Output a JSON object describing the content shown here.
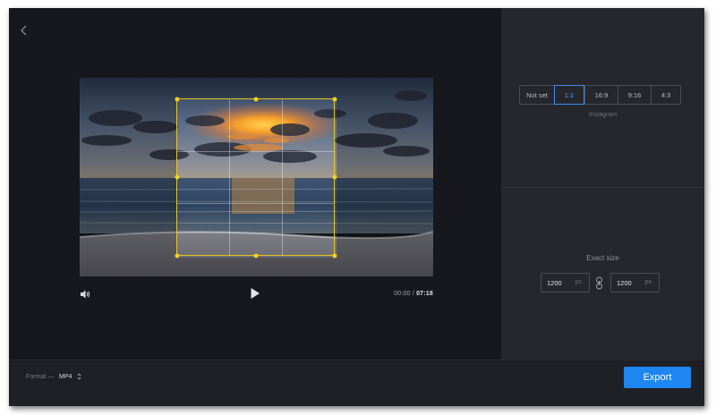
{
  "window": {
    "back_icon": "chevron-left-icon"
  },
  "player": {
    "current_time": "00:00",
    "separator": "/",
    "total_time": "07:18",
    "volume_icon": "speaker-icon",
    "play_icon": "play-icon"
  },
  "crop": {
    "border_color": "#e7c51d"
  },
  "aspect_ratio": {
    "options": [
      "Not set",
      "1:1",
      "16:9",
      "9:16",
      "4:3"
    ],
    "selected": "1:1",
    "caption": "Instagram"
  },
  "exact_size": {
    "label": "Exact size",
    "width": "1200",
    "height": "1200",
    "unit": "px",
    "link_icon": "chain-link-icon"
  },
  "bottom": {
    "format_label": "Format —",
    "format_value": "MP4",
    "export_label": "Export"
  },
  "colors": {
    "accent": "#1e86f0",
    "background": "#17181d",
    "panel": "#26272c"
  }
}
